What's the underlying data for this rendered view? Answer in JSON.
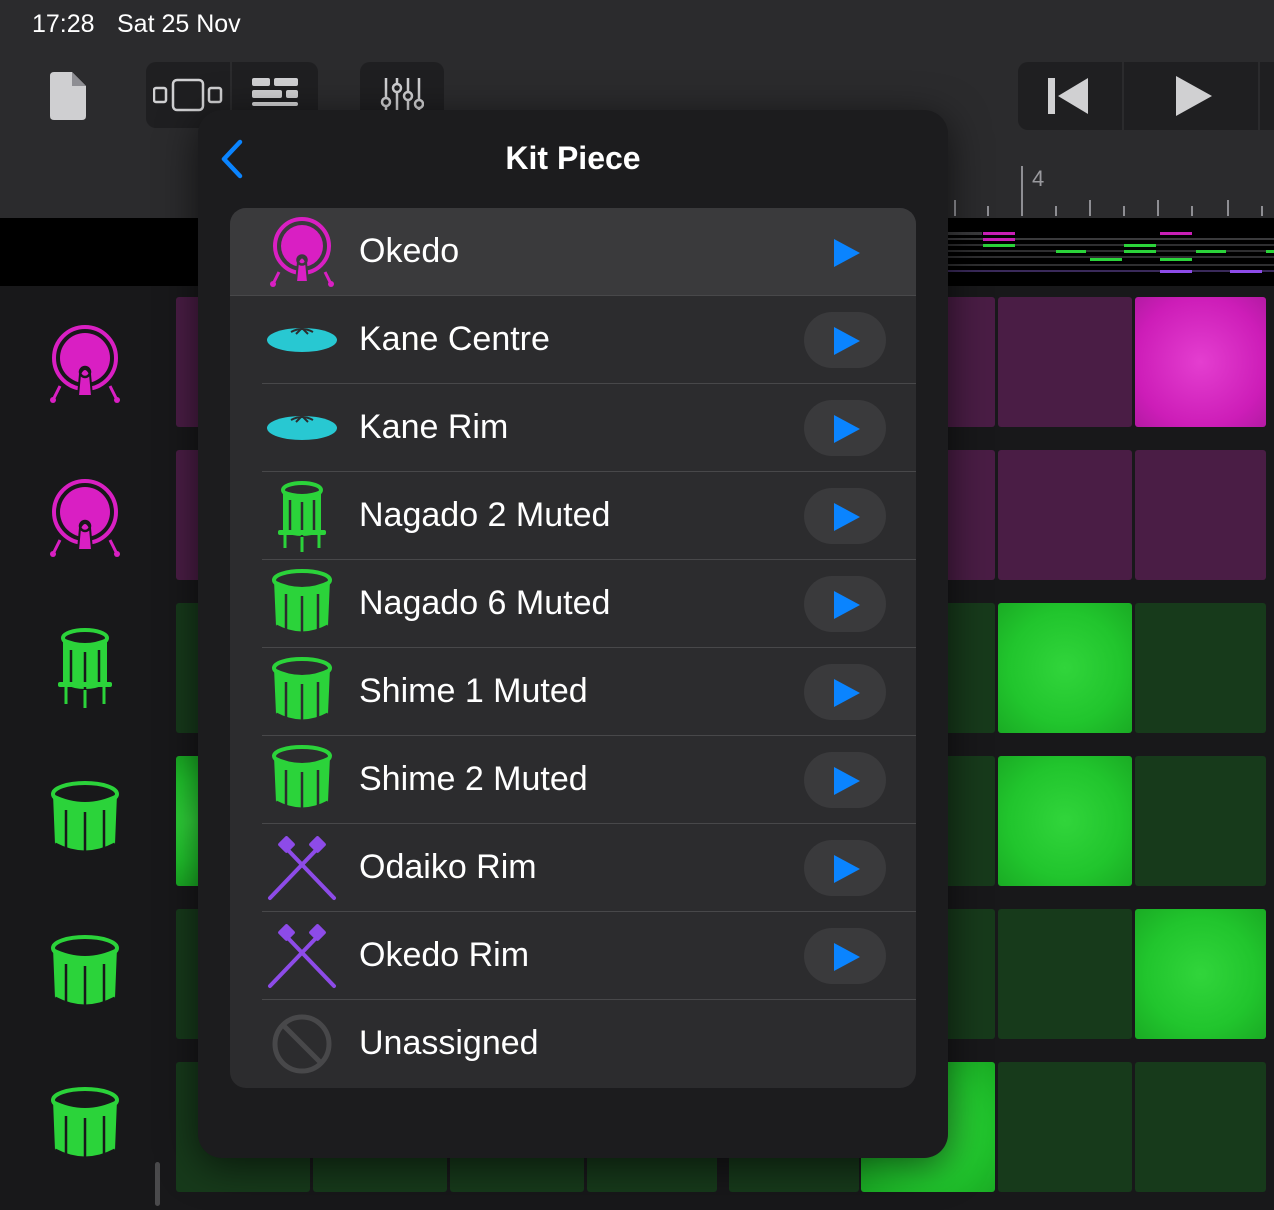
{
  "status": {
    "time": "17:28",
    "date": "Sat 25 Nov"
  },
  "ruler": {
    "bar_number": "4"
  },
  "popover": {
    "title": "Kit Piece",
    "items": [
      {
        "label": "Okedo",
        "icon": "okedo-drum-icon",
        "color": "#d91fc3",
        "selected": true
      },
      {
        "label": "Kane Centre",
        "icon": "kane-gong-icon",
        "color": "#28c8d2"
      },
      {
        "label": "Kane Rim",
        "icon": "kane-gong-icon",
        "color": "#28c8d2"
      },
      {
        "label": "Nagado 2 Muted",
        "icon": "tall-drum-icon",
        "color": "#2bd33a"
      },
      {
        "label": "Nagado 6 Muted",
        "icon": "barrel-drum-icon",
        "color": "#2bd33a"
      },
      {
        "label": "Shime 1 Muted",
        "icon": "barrel-drum-icon",
        "color": "#2bd33a"
      },
      {
        "label": "Shime 2 Muted",
        "icon": "barrel-drum-icon",
        "color": "#2bd33a"
      },
      {
        "label": "Odaiko Rim",
        "icon": "crossed-sticks-icon",
        "color": "#8d4be8"
      },
      {
        "label": "Okedo Rim",
        "icon": "crossed-sticks-icon",
        "color": "#8d4be8"
      },
      {
        "label": "Unassigned",
        "icon": "prohibited-icon",
        "color": "#3a3a3c"
      }
    ]
  },
  "colors": {
    "accent": "#0a84ff",
    "pink": "#d91fc3",
    "green": "#2bd33a",
    "purple": "#8d4be8",
    "cyan": "#28c8d2"
  }
}
